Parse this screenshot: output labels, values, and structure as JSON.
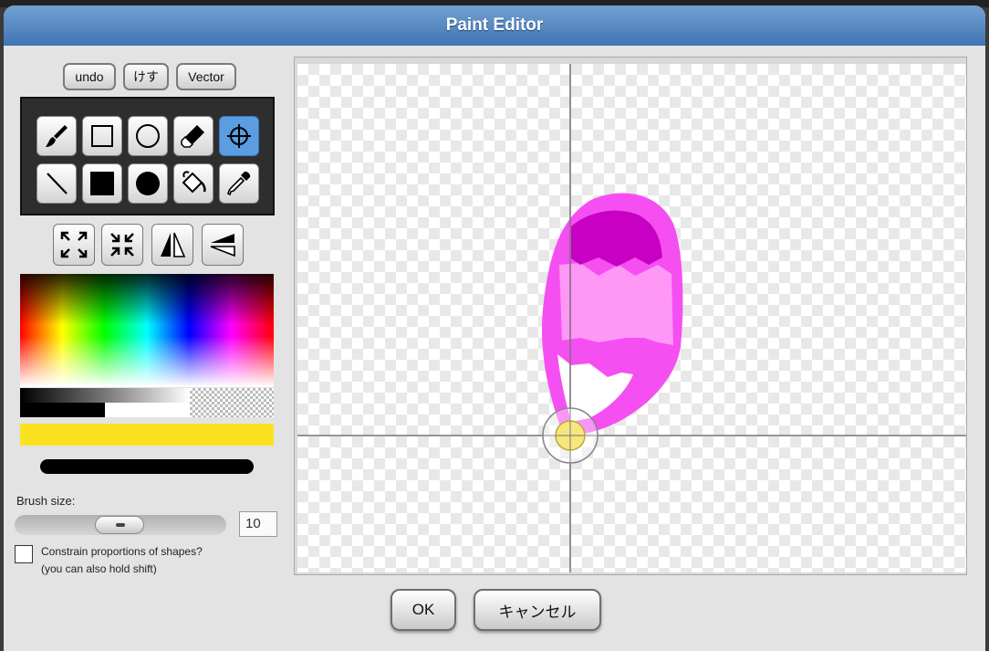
{
  "window": {
    "title": "Paint Editor"
  },
  "toolbar": {
    "undo_label": "undo",
    "clear_label": "けす",
    "vector_label": "Vector"
  },
  "tools": [
    {
      "name": "brush",
      "icon": "brush-icon"
    },
    {
      "name": "rectangle",
      "icon": "rectangle-outline-icon"
    },
    {
      "name": "ellipse",
      "icon": "ellipse-outline-icon"
    },
    {
      "name": "eraser",
      "icon": "eraser-icon"
    },
    {
      "name": "rotation-center",
      "icon": "crosshair-icon",
      "active": true
    },
    {
      "name": "line",
      "icon": "line-icon"
    },
    {
      "name": "filled-rectangle",
      "icon": "filled-rectangle-icon"
    },
    {
      "name": "filled-ellipse",
      "icon": "filled-ellipse-icon"
    },
    {
      "name": "paint-bucket",
      "icon": "paint-bucket-icon"
    },
    {
      "name": "eyedropper",
      "icon": "eyedropper-icon"
    }
  ],
  "transforms": [
    {
      "name": "grow",
      "icon": "expand-arrows-icon"
    },
    {
      "name": "shrink",
      "icon": "shrink-arrows-icon"
    },
    {
      "name": "flip-horizontal",
      "icon": "flip-horizontal-icon"
    },
    {
      "name": "flip-vertical",
      "icon": "flip-vertical-icon"
    }
  ],
  "colors": {
    "current": "#fbe221",
    "accent": "#5a9de0",
    "blob_outline": "#f54ff2",
    "blob_fill": "#ff97f6",
    "blob_dark": "#c800c4"
  },
  "brush": {
    "label": "Brush size:",
    "value": "10"
  },
  "constrain": {
    "checked": false,
    "line1": "Constrain proportions of shapes?",
    "line2": "(you can also hold shift)"
  },
  "buttons": {
    "ok": "OK",
    "cancel": "キャンセル"
  }
}
